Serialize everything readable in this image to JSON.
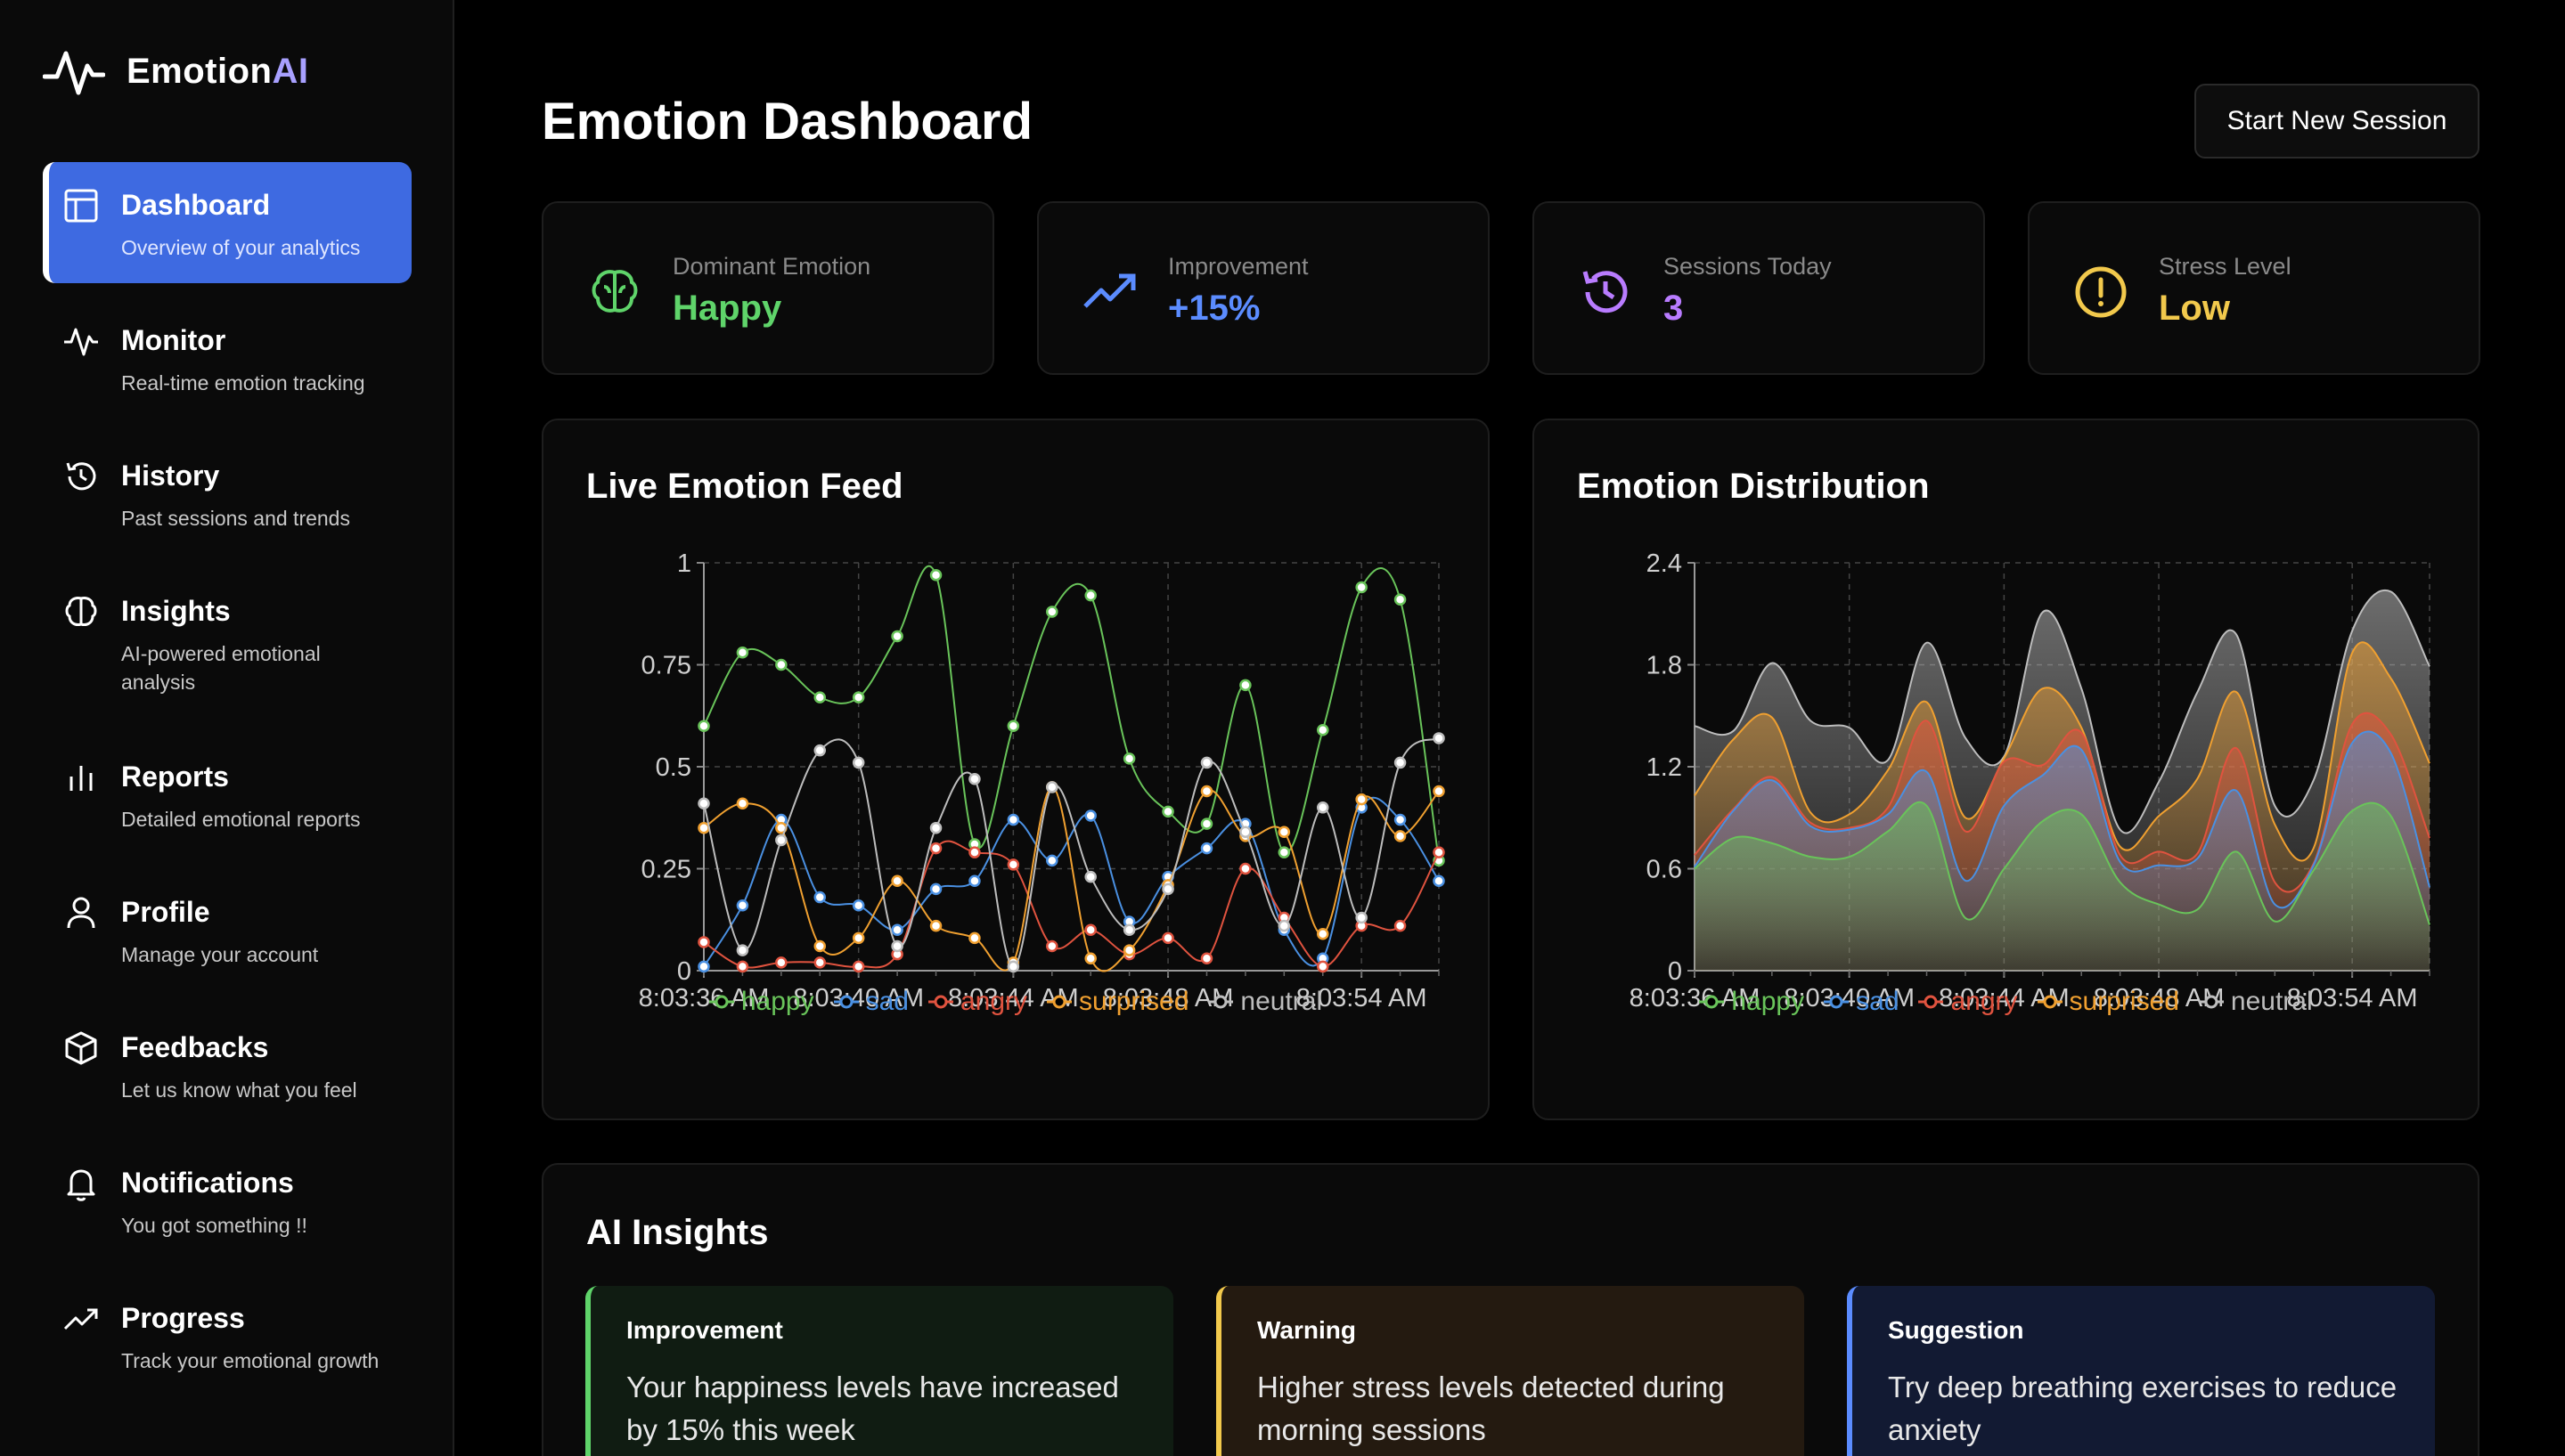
{
  "app": {
    "name_part1": "Emotion",
    "name_part2": "AI"
  },
  "sidebar": {
    "items": [
      {
        "title": "Dashboard",
        "subtitle": "Overview of your analytics",
        "icon": "dashboard-icon"
      },
      {
        "title": "Monitor",
        "subtitle": "Real-time emotion tracking",
        "icon": "pulse-icon"
      },
      {
        "title": "History",
        "subtitle": "Past sessions and trends",
        "icon": "history-icon"
      },
      {
        "title": "Insights",
        "subtitle": "AI-powered emotional analysis",
        "icon": "brain-icon"
      },
      {
        "title": "Reports",
        "subtitle": "Detailed emotional reports",
        "icon": "bar-chart-icon"
      },
      {
        "title": "Profile",
        "subtitle": "Manage your account",
        "icon": "user-icon"
      },
      {
        "title": "Feedbacks",
        "subtitle": "Let us know what you feel",
        "icon": "box-icon"
      },
      {
        "title": "Notifications",
        "subtitle": "You got something !!",
        "icon": "bell-icon"
      },
      {
        "title": "Progress",
        "subtitle": "Track your emotional growth",
        "icon": "trending-up-icon"
      }
    ]
  },
  "header": {
    "title": "Emotion Dashboard",
    "new_session_label": "Start New Session"
  },
  "stats": [
    {
      "label": "Dominant Emotion",
      "value": "Happy",
      "color": "#5fd46a",
      "icon": "brain-icon"
    },
    {
      "label": "Improvement",
      "value": "+15%",
      "color": "#5b8cff",
      "icon": "trending-up-icon"
    },
    {
      "label": "Sessions Today",
      "value": "3",
      "color": "#b97cff",
      "icon": "history-icon"
    },
    {
      "label": "Stress Level",
      "value": "Low",
      "color": "#f2c94c",
      "icon": "alert-circle-icon"
    }
  ],
  "charts": {
    "live_title": "Live Emotion Feed",
    "dist_title": "Emotion Distribution"
  },
  "legend": [
    "happy",
    "sad",
    "angry",
    "surprised",
    "neutral"
  ],
  "colors": {
    "happy": "#69c45a",
    "sad": "#4a90e2",
    "angry": "#e0533f",
    "surprised": "#f0a030",
    "neutral": "#bdbdbd"
  },
  "chart_data": [
    {
      "type": "line",
      "title": "Live Emotion Feed",
      "ylim": [
        0,
        1
      ],
      "yticks": [
        "0",
        "0.25",
        "0.5",
        "0.75",
        "1"
      ],
      "xticks": [
        "8:03:36 AM",
        "8:03:40 AM",
        "8:03:44 AM",
        "8:03:48 AM",
        "8:03:54 AM"
      ],
      "grid": true,
      "legend_position": "bottom",
      "series": [
        {
          "name": "happy",
          "values": [
            0.6,
            0.78,
            0.75,
            0.67,
            0.67,
            0.82,
            0.97,
            0.31,
            0.6,
            0.88,
            0.92,
            0.52,
            0.39,
            0.36,
            0.7,
            0.29,
            0.59,
            0.94,
            0.91,
            0.27
          ]
        },
        {
          "name": "sad",
          "values": [
            0.01,
            0.16,
            0.37,
            0.18,
            0.16,
            0.1,
            0.2,
            0.22,
            0.37,
            0.27,
            0.38,
            0.12,
            0.23,
            0.3,
            0.36,
            0.1,
            0.03,
            0.4,
            0.37,
            0.22
          ]
        },
        {
          "name": "angry",
          "values": [
            0.07,
            0.01,
            0.02,
            0.02,
            0.01,
            0.04,
            0.3,
            0.29,
            0.26,
            0.06,
            0.1,
            0.04,
            0.08,
            0.03,
            0.25,
            0.13,
            0.01,
            0.11,
            0.11,
            0.29
          ]
        },
        {
          "name": "surprised",
          "values": [
            0.35,
            0.41,
            0.35,
            0.06,
            0.08,
            0.22,
            0.11,
            0.08,
            0.02,
            0.45,
            0.03,
            0.05,
            0.21,
            0.44,
            0.33,
            0.34,
            0.09,
            0.42,
            0.33,
            0.44
          ]
        },
        {
          "name": "neutral",
          "values": [
            0.41,
            0.05,
            0.32,
            0.54,
            0.51,
            0.06,
            0.35,
            0.47,
            0.01,
            0.45,
            0.23,
            0.1,
            0.2,
            0.51,
            0.34,
            0.11,
            0.4,
            0.13,
            0.51,
            0.57
          ]
        }
      ]
    },
    {
      "type": "area",
      "title": "Emotion Distribution",
      "stacked": true,
      "ylim": [
        0,
        2.4
      ],
      "yticks": [
        "0",
        "0.6",
        "1.2",
        "1.8",
        "2.4"
      ],
      "xticks": [
        "8:03:36 AM",
        "8:03:40 AM",
        "8:03:44 AM",
        "8:03:48 AM",
        "8:03:54 AM"
      ],
      "grid": true,
      "legend_position": "bottom",
      "series": [
        {
          "name": "happy",
          "values": [
            0.6,
            0.78,
            0.75,
            0.67,
            0.67,
            0.82,
            0.97,
            0.31,
            0.6,
            0.88,
            0.92,
            0.52,
            0.39,
            0.36,
            0.7,
            0.29,
            0.59,
            0.94,
            0.91,
            0.27
          ]
        },
        {
          "name": "sad",
          "values": [
            0.01,
            0.16,
            0.37,
            0.18,
            0.16,
            0.1,
            0.2,
            0.22,
            0.37,
            0.27,
            0.38,
            0.12,
            0.23,
            0.3,
            0.36,
            0.1,
            0.03,
            0.4,
            0.37,
            0.22
          ]
        },
        {
          "name": "angry",
          "values": [
            0.07,
            0.01,
            0.02,
            0.02,
            0.01,
            0.04,
            0.3,
            0.29,
            0.26,
            0.06,
            0.1,
            0.04,
            0.08,
            0.03,
            0.25,
            0.13,
            0.01,
            0.11,
            0.11,
            0.29
          ]
        },
        {
          "name": "surprised",
          "values": [
            0.35,
            0.41,
            0.35,
            0.06,
            0.08,
            0.22,
            0.11,
            0.08,
            0.02,
            0.45,
            0.03,
            0.05,
            0.21,
            0.44,
            0.33,
            0.34,
            0.09,
            0.42,
            0.33,
            0.44
          ]
        },
        {
          "name": "neutral",
          "values": [
            0.41,
            0.05,
            0.32,
            0.54,
            0.51,
            0.06,
            0.35,
            0.47,
            0.01,
            0.45,
            0.23,
            0.1,
            0.2,
            0.51,
            0.34,
            0.11,
            0.4,
            0.13,
            0.51,
            0.57
          ]
        }
      ]
    }
  ],
  "insights": {
    "title": "AI Insights",
    "cards": [
      {
        "type": "Improvement",
        "text": "Your happiness levels have increased by 15% this week",
        "accent": "#5fd46a",
        "bg": "#101c12"
      },
      {
        "type": "Warning",
        "text": "Higher stress levels detected during morning sessions",
        "accent": "#f2c94c",
        "bg": "#241a10"
      },
      {
        "type": "Suggestion",
        "text": "Try deep breathing exercises to reduce anxiety",
        "accent": "#5b8cff",
        "bg": "#121a33"
      }
    ]
  }
}
